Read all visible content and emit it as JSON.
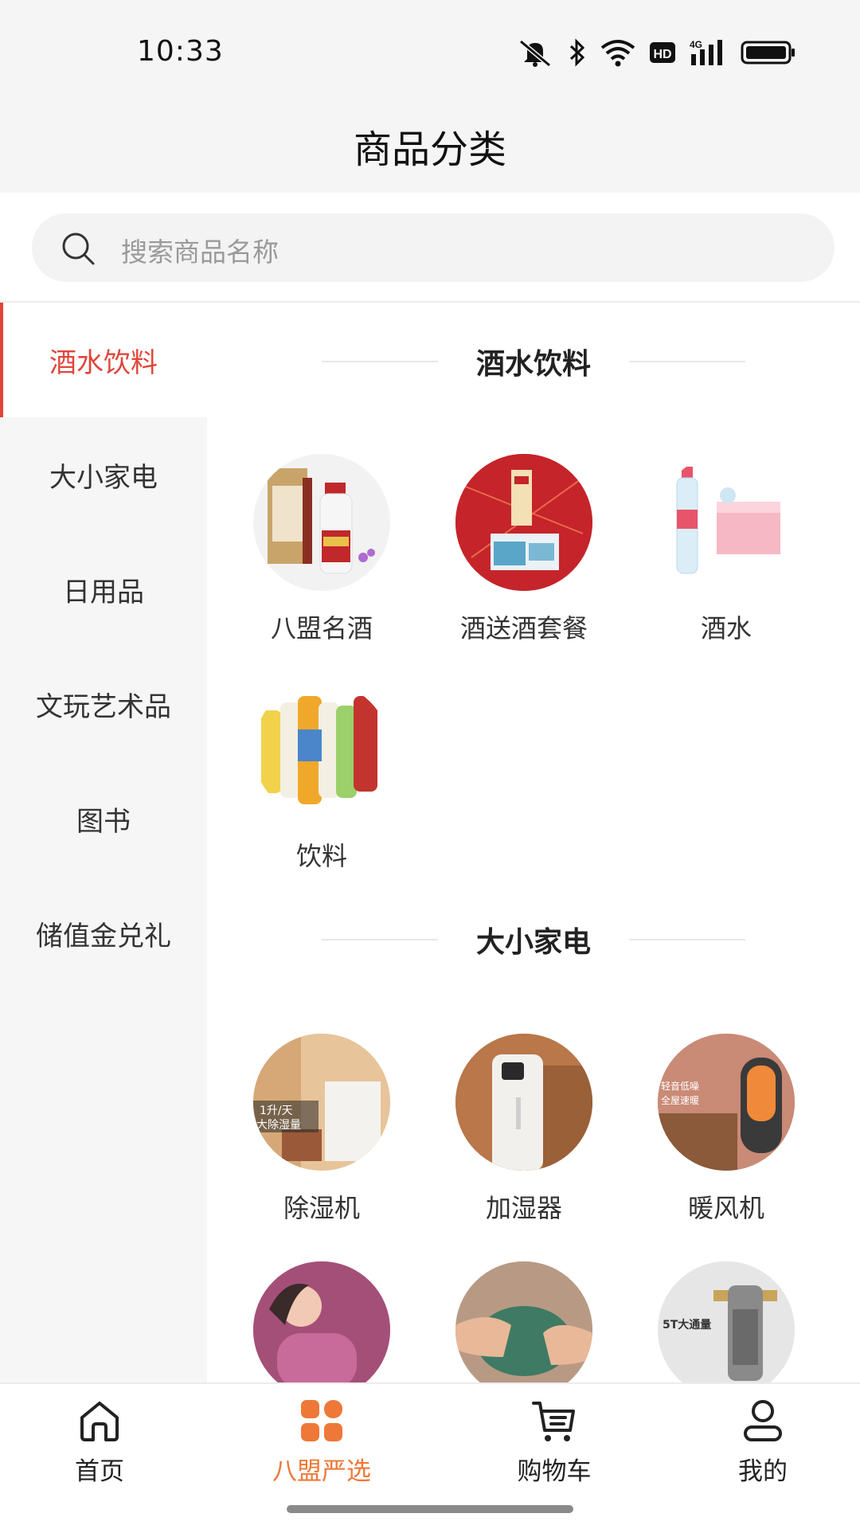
{
  "status_bar": {
    "time": "10:33",
    "icons": [
      "mute-icon",
      "bluetooth-icon",
      "wifi-icon",
      "hd-icon",
      "signal-4g-icon",
      "battery-icon"
    ],
    "hd_text": "HD",
    "net_text": "4G"
  },
  "header": {
    "title": "商品分类"
  },
  "search": {
    "placeholder": "搜索商品名称"
  },
  "sidebar": {
    "items": [
      {
        "label": "酒水饮料",
        "active": true
      },
      {
        "label": "大小家电",
        "active": false
      },
      {
        "label": "日用品",
        "active": false
      },
      {
        "label": "文玩艺术品",
        "active": false
      },
      {
        "label": "图书",
        "active": false
      },
      {
        "label": "储值金兑礼",
        "active": false
      }
    ]
  },
  "sections": [
    {
      "title": "酒水饮料",
      "items": [
        {
          "label": "八盟名酒",
          "image": "liquor-bottles-image"
        },
        {
          "label": "酒送酒套餐",
          "image": "gift-box-image"
        },
        {
          "label": "酒水",
          "image": "evian-water-image"
        },
        {
          "label": "饮料",
          "image": "tea-drinks-image"
        }
      ]
    },
    {
      "title": "大小家电",
      "items": [
        {
          "label": "除湿机",
          "image": "dehumidifier-image",
          "overlay": [
            "1升/天",
            "大除湿量"
          ]
        },
        {
          "label": "加湿器",
          "image": "humidifier-image"
        },
        {
          "label": "暖风机",
          "image": "heater-image",
          "overlay": [
            "轻音低噪",
            "全屋速暖"
          ]
        },
        {
          "label": "",
          "image": "massager-image"
        },
        {
          "label": "",
          "image": "hand-warmer-image"
        },
        {
          "label": "",
          "image": "water-filter-image",
          "overlay": [
            "5T大通量"
          ]
        }
      ]
    }
  ],
  "tabbar": {
    "items": [
      {
        "label": "首页",
        "icon": "home-icon",
        "active": false
      },
      {
        "label": "八盟严选",
        "icon": "grid-icon",
        "active": true
      },
      {
        "label": "购物车",
        "icon": "cart-icon",
        "active": false
      },
      {
        "label": "我的",
        "icon": "user-icon",
        "active": false
      }
    ]
  },
  "colors": {
    "accent": "#e0463a",
    "tab_active": "#ee7838",
    "sidebar_bg": "#f6f6f6"
  }
}
